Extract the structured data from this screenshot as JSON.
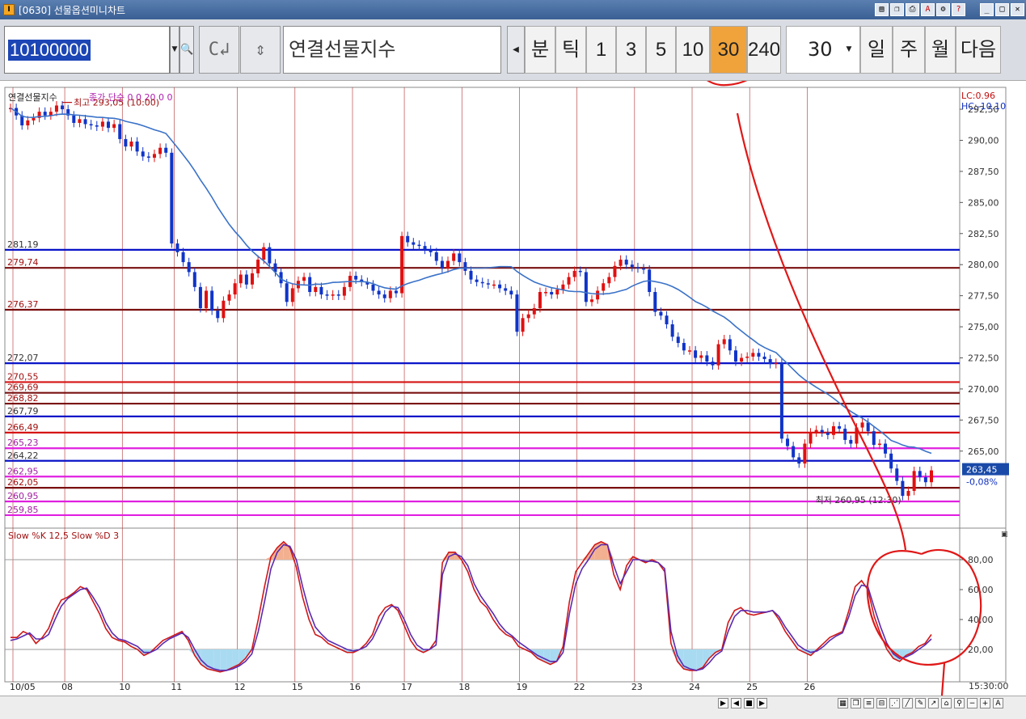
{
  "window": {
    "title": "[0630]  선물옵션미니차트",
    "app_icon": "I"
  },
  "toolbar": {
    "code_value": "10100000",
    "index_name": "연결선물지수",
    "period_buttons": [
      "분",
      "틱",
      "1",
      "3",
      "5",
      "10",
      "30",
      "240"
    ],
    "active_period": "30",
    "period_select_value": "30",
    "range_buttons": [
      "일",
      "주",
      "월",
      "다음"
    ]
  },
  "chart_data": [
    {
      "type": "candlestick",
      "legend": [
        "연결선물지수",
        "종가 단순 0 0 20 0 0"
      ],
      "top_right_labels": [
        "LC:0.96",
        "HC:-10.10"
      ],
      "y_ticks": [
        "292,50",
        "290,00",
        "287,50",
        "285,00",
        "282,50",
        "280,00",
        "277,50",
        "275,00",
        "272,50",
        "270,00",
        "267,50",
        "265,00"
      ],
      "ylim": [
        259.0,
        294.0
      ],
      "x_labels": [
        "10/05",
        "08",
        "10",
        "11",
        "12",
        "15",
        "16",
        "17",
        "18",
        "19",
        "22",
        "23",
        "24",
        "25",
        "26"
      ],
      "annotations": [
        {
          "text": "최고 293,05 (10:00)",
          "value": 293.05
        },
        {
          "text": "최저 260,95 (12:30)",
          "value": 260.95
        }
      ],
      "current_price": {
        "value": "263,45",
        "change": "-0,08%"
      },
      "horizontal_lines": [
        {
          "label": "281,19",
          "value": 281.19,
          "color": "#0a14c8"
        },
        {
          "label": "279,74",
          "value": 279.74,
          "color": "#7a1010"
        },
        {
          "label": "276,37",
          "value": 276.37,
          "color": "#7a1010"
        },
        {
          "label": "272,07",
          "value": 272.07,
          "color": "#0a14c8"
        },
        {
          "label": "270,55",
          "value": 270.55,
          "color": "#d61414"
        },
        {
          "label": "269,69",
          "value": 269.69,
          "color": "#7a1010"
        },
        {
          "label": "268,82",
          "value": 268.82,
          "color": "#7a1010"
        },
        {
          "label": "267,79",
          "value": 267.79,
          "color": "#0a14c8"
        },
        {
          "label": "266,49",
          "value": 266.49,
          "color": "#d61414"
        },
        {
          "label": "265,23",
          "value": 265.23,
          "color": "#e020e0"
        },
        {
          "label": "264,22",
          "value": 264.22,
          "color": "#0a14c8"
        },
        {
          "label": "262,95",
          "value": 262.95,
          "color": "#e020e0"
        },
        {
          "label": "262,05",
          "value": 262.05,
          "color": "#7a1010"
        },
        {
          "label": "260,95",
          "value": 260.95,
          "color": "#e020e0"
        },
        {
          "label": "259,85",
          "value": 259.85,
          "color": "#e020e0"
        }
      ],
      "close_series": [
        292.6,
        292.0,
        291.2,
        291.6,
        291.8,
        292.3,
        292.0,
        292.3,
        292.8,
        292.5,
        292.0,
        291.4,
        291.7,
        291.3,
        291.2,
        291.1,
        291.5,
        291.0,
        291.3,
        290.1,
        289.5,
        289.9,
        289.1,
        288.7,
        288.6,
        288.9,
        289.4,
        289.0,
        281.7,
        281.0,
        280.2,
        279.4,
        278.2,
        276.5,
        277.9,
        276.3,
        275.7,
        277.1,
        277.6,
        278.5,
        279.2,
        278.4,
        279.3,
        280.4,
        281.4,
        280.1,
        279.4,
        278.5,
        277.0,
        278.1,
        278.7,
        279.0,
        277.8,
        278.2,
        277.6,
        277.5,
        277.6,
        277.5,
        278.2,
        279.1,
        278.8,
        278.6,
        278.4,
        277.9,
        277.6,
        277.3,
        277.9,
        277.7,
        282.3,
        281.8,
        281.6,
        281.5,
        281.2,
        281.0,
        280.3,
        279.7,
        280.3,
        280.9,
        280.2,
        279.5,
        278.8,
        278.6,
        278.5,
        278.4,
        278.4,
        278.1,
        277.9,
        277.6,
        274.6,
        275.7,
        276.0,
        276.5,
        277.8,
        277.8,
        277.6,
        278.0,
        278.4,
        279.0,
        279.5,
        279.4,
        277.0,
        277.2,
        277.9,
        278.5,
        279.0,
        279.9,
        280.4,
        280.0,
        279.8,
        279.7,
        279.6,
        277.8,
        276.2,
        275.9,
        275.2,
        274.2,
        273.7,
        273.1,
        273.1,
        272.5,
        272.7,
        272.2,
        271.9,
        273.6,
        274.0,
        273.1,
        272.2,
        272.5,
        272.6,
        272.9,
        272.6,
        272.4,
        272.0,
        272.1,
        266.0,
        265.4,
        264.5,
        264.0,
        265.6,
        266.5,
        266.7,
        266.5,
        266.3,
        267.0,
        266.8,
        265.9,
        265.6,
        266.9,
        267.3,
        266.6,
        265.5,
        265.6,
        264.8,
        263.6,
        262.6,
        261.4,
        261.8,
        263.4,
        262.9,
        262.5,
        263.45
      ],
      "ma20_color": "#3a72c8",
      "up_color": "#e01010",
      "down_color": "#1034c8"
    },
    {
      "type": "line",
      "legend": "Slow %K 12,5  Slow %D 3",
      "y_ticks": [
        "80,00",
        "60,00",
        "40,00",
        "20,00"
      ],
      "ylim": [
        0,
        100
      ],
      "time_label": "15:30:00",
      "series": [
        {
          "name": "Slow %K 12,5",
          "color": "#d01818",
          "values": [
            28,
            28,
            32,
            30,
            24,
            28,
            34,
            45,
            53,
            55,
            58,
            62,
            60,
            52,
            44,
            34,
            28,
            26,
            25,
            22,
            20,
            16,
            18,
            22,
            26,
            28,
            30,
            32,
            26,
            16,
            10,
            7,
            6,
            5,
            6,
            8,
            10,
            14,
            20,
            40,
            62,
            82,
            88,
            92,
            88,
            75,
            55,
            40,
            30,
            28,
            24,
            22,
            20,
            18,
            18,
            20,
            24,
            30,
            42,
            48,
            50,
            46,
            36,
            26,
            20,
            18,
            20,
            26,
            78,
            85,
            85,
            80,
            72,
            60,
            52,
            48,
            40,
            34,
            30,
            28,
            22,
            20,
            18,
            14,
            12,
            10,
            12,
            22,
            52,
            72,
            78,
            84,
            90,
            92,
            90,
            70,
            60,
            76,
            82,
            80,
            78,
            80,
            78,
            72,
            24,
            12,
            7,
            6,
            6,
            8,
            14,
            18,
            20,
            38,
            46,
            48,
            44,
            43,
            44,
            45,
            46,
            40,
            32,
            26,
            20,
            18,
            16,
            20,
            24,
            28,
            30,
            32,
            46,
            62,
            66,
            60,
            42,
            30,
            20,
            14,
            12,
            16,
            18,
            22,
            24,
            30
          ]
        },
        {
          "name": "Slow %D 3",
          "color": "#5a2ab0",
          "values": [
            26,
            27,
            29,
            31,
            27,
            27,
            30,
            40,
            49,
            54,
            57,
            60,
            61,
            55,
            48,
            38,
            31,
            27,
            26,
            24,
            22,
            18,
            18,
            20,
            24,
            27,
            29,
            31,
            28,
            20,
            13,
            9,
            7,
            6,
            6,
            7,
            9,
            12,
            17,
            32,
            52,
            74,
            85,
            90,
            89,
            80,
            62,
            46,
            35,
            30,
            26,
            24,
            22,
            20,
            19,
            20,
            22,
            27,
            36,
            45,
            49,
            48,
            40,
            30,
            23,
            20,
            20,
            23,
            70,
            82,
            84,
            82,
            76,
            64,
            56,
            50,
            44,
            37,
            32,
            29,
            25,
            22,
            19,
            16,
            14,
            12,
            12,
            18,
            44,
            64,
            74,
            80,
            87,
            90,
            90,
            76,
            64,
            72,
            80,
            80,
            79,
            79,
            78,
            74,
            32,
            16,
            9,
            7,
            6,
            7,
            11,
            16,
            19,
            32,
            42,
            46,
            46,
            45,
            45,
            45,
            46,
            42,
            35,
            29,
            23,
            20,
            18,
            19,
            22,
            26,
            29,
            31,
            42,
            56,
            63,
            62,
            48,
            35,
            24,
            17,
            14,
            15,
            17,
            20,
            23,
            27
          ]
        }
      ]
    }
  ]
}
